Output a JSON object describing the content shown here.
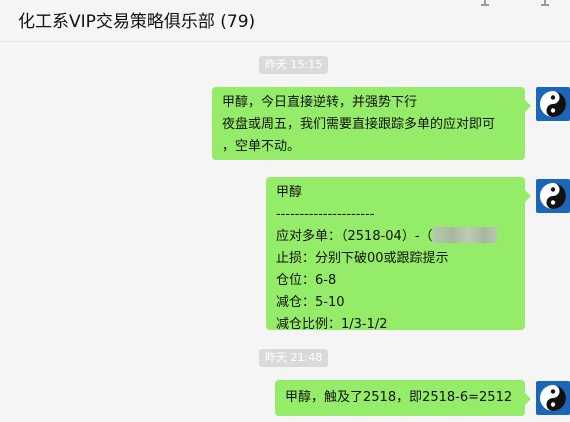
{
  "header": {
    "title": "化工系VIP交易策略俱乐部 (79)"
  },
  "messages": [
    {
      "timestamp": "昨天 15:15",
      "lines": [
        "甲醇，今日直接逆转，并强势下行",
        "夜盘或周五，我们需要直接跟踪多单的应对即可",
        "，空单不动。"
      ]
    },
    {
      "lines": [
        "甲醇",
        "---------------------",
        "应对多单：（2518-04）-（",
        "止损：分别下破00或跟踪提示",
        "仓位：6-8",
        "减仓：5-10",
        "减仓比例：1/3-1/2"
      ]
    },
    {
      "timestamp": "昨天 21:48",
      "lines": [
        "甲醇，触及了2518，即2518-6=2512"
      ]
    }
  ],
  "colors": {
    "bubble": "#95ec69",
    "background": "#f5f5f5",
    "avatar": "#1b66b8"
  },
  "icons": {
    "avatar": "yin-yang-icon"
  }
}
